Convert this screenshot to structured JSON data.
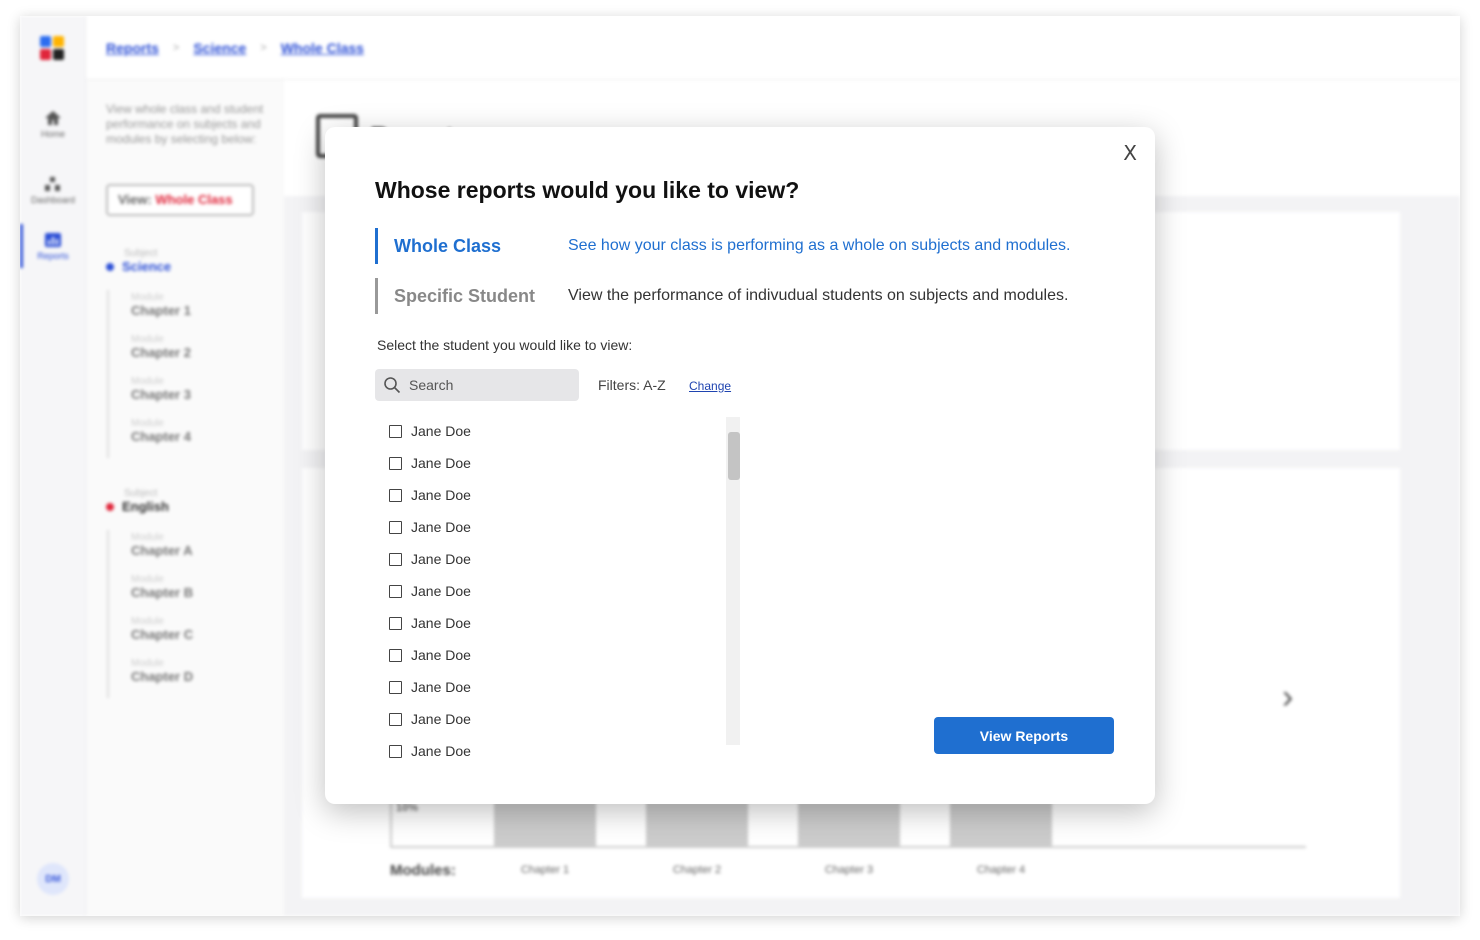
{
  "breadcrumb": [
    "Reports",
    "Science",
    "Whole Class"
  ],
  "rail": {
    "items": [
      {
        "label": "Home",
        "icon": "home-icon"
      },
      {
        "label": "Dashboard",
        "icon": "dashboard-icon"
      },
      {
        "label": "Reports",
        "icon": "reports-icon"
      }
    ],
    "avatar": "DM"
  },
  "sidepanel": {
    "description": "View whole class and student performance on subjects and modules by selecting below:",
    "view_label": "View: ",
    "view_value": "Whole Class",
    "subject_label": "Subject",
    "module_label": "Module",
    "subjects": [
      {
        "name": "Science",
        "color": "#2c4fd6",
        "modules": [
          "Chapter 1",
          "Chapter 2",
          "Chapter 3",
          "Chapter 4"
        ]
      },
      {
        "name": "English",
        "color": "#e0263b",
        "modules": [
          "Chapter A",
          "Chapter B",
          "Chapter C",
          "Chapter D"
        ]
      }
    ]
  },
  "main": {
    "title": "Reports",
    "chart_y_label": "10%",
    "chart_x_title": "Modules:",
    "chart_categories": [
      "Chapter 1",
      "Chapter 2",
      "Chapter 3",
      "Chapter 4"
    ]
  },
  "modal": {
    "close": "X",
    "title": "Whose reports would you like to view?",
    "options": [
      {
        "name": "Whole Class",
        "description": "See how your class is performing as a whole on subjects and modules."
      },
      {
        "name": "Specific Student",
        "description": "View the performance of indivudual students on subjects and modules."
      }
    ],
    "instruction": "Select the student you would like to view:",
    "search_placeholder": "Search",
    "filters_label": "Filters: A-Z",
    "change_label": "Change",
    "students": [
      "Jane Doe",
      "Jane Doe",
      "Jane Doe",
      "Jane Doe",
      "Jane Doe",
      "Jane Doe",
      "Jane Doe",
      "Jane Doe",
      "Jane Doe",
      "Jane Doe",
      "Jane Doe"
    ],
    "view_button": "View Reports"
  }
}
